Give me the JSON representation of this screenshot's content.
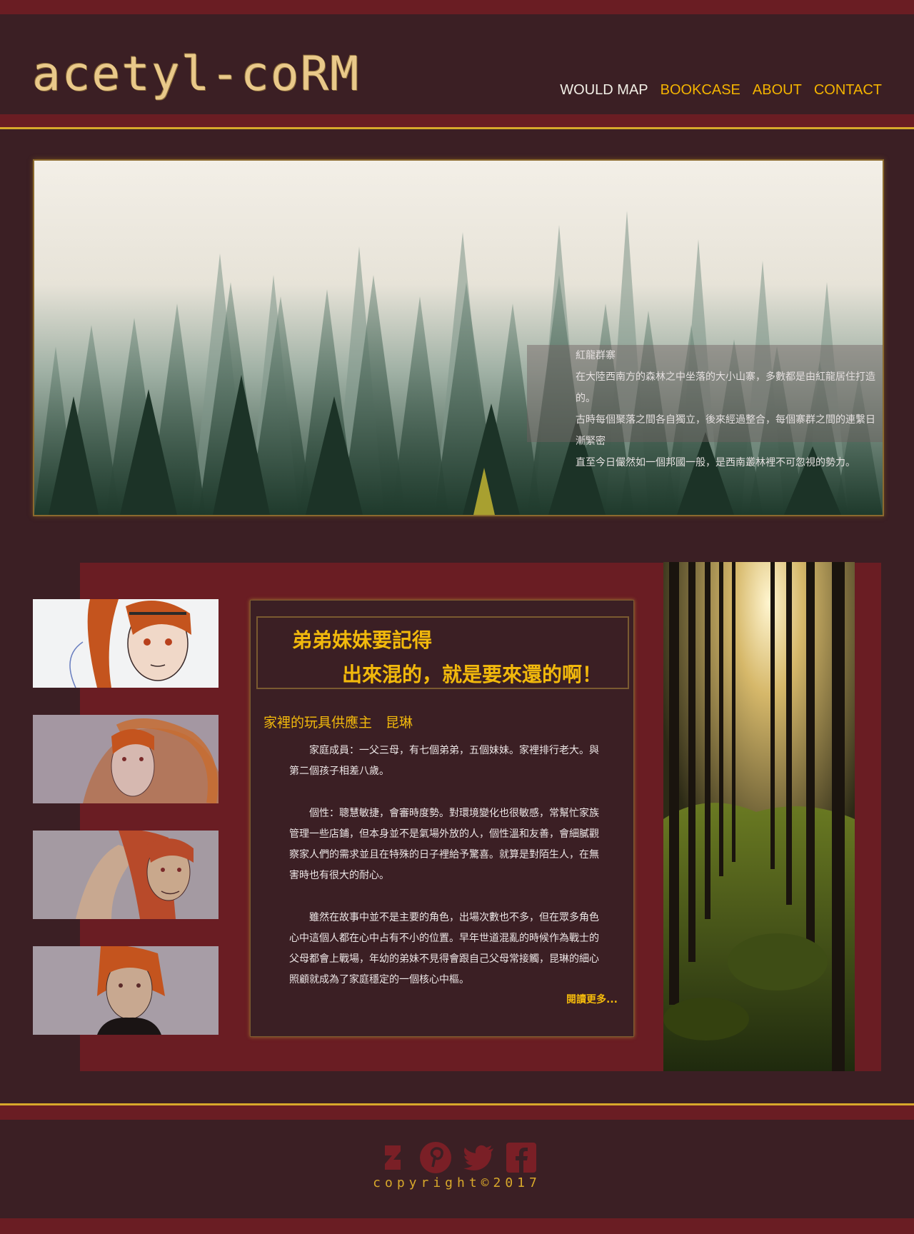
{
  "header": {
    "logo": "acetyl-coRM",
    "nav": [
      "WOULD MAP",
      "BOOKCASE",
      "ABOUT",
      "CONTACT"
    ]
  },
  "hero": {
    "caption_title": "紅龍群寨",
    "caption_lines": [
      "在大陸西南方的森林之中坐落的大小山寨，多數都是由紅龍居住打造的。",
      "古時每個聚落之間各自獨立，後來經過整合，每個寨群之間的連繫日漸緊密",
      "直至今日儼然如一個邦國一般，是西南叢林裡不可忽視的勢力。"
    ]
  },
  "card": {
    "quote_line1": "弟弟妹妹要記得",
    "quote_line2": "出來混的，就是要來還的啊！",
    "title": "家裡的玩具供應主　昆琳",
    "paragraphs": [
      "　　家庭成員：一父三母，有七個弟弟，五個妹妹。家裡排行老大。與第二個孩子相差八歲。",
      "　　個性：聰慧敏捷，會審時度勢。對環境變化也很敏感，常幫忙家族管理一些店鋪，但本身並不是氣場外放的人，個性溫和友善，會細膩觀察家人們的需求並且在特殊的日子裡給予驚喜。就算是對陌生人，在無害時也有很大的耐心。",
      "　　雖然在故事中並不是主要的角色，出場次數也不多，但在眾多角色心中這個人都在心中占有不小的位置。早年世道混亂的時候作為戰士的父母都會上戰場，年幼的弟妹不見得會跟自己父母常接觸，昆琳的細心照顧就成為了家庭穩定的一個核心中樞。"
    ],
    "read_more": "閱讀更多..."
  },
  "footer": {
    "social_icons": [
      "deviantart-icon",
      "pinterest-icon",
      "twitter-icon",
      "facebook-icon"
    ],
    "copyright": "copyright©2017"
  },
  "colors": {
    "background": "#3b1f24",
    "band": "#6a1d23",
    "gold": "#d8a82b",
    "accent": "#f2b90c"
  }
}
